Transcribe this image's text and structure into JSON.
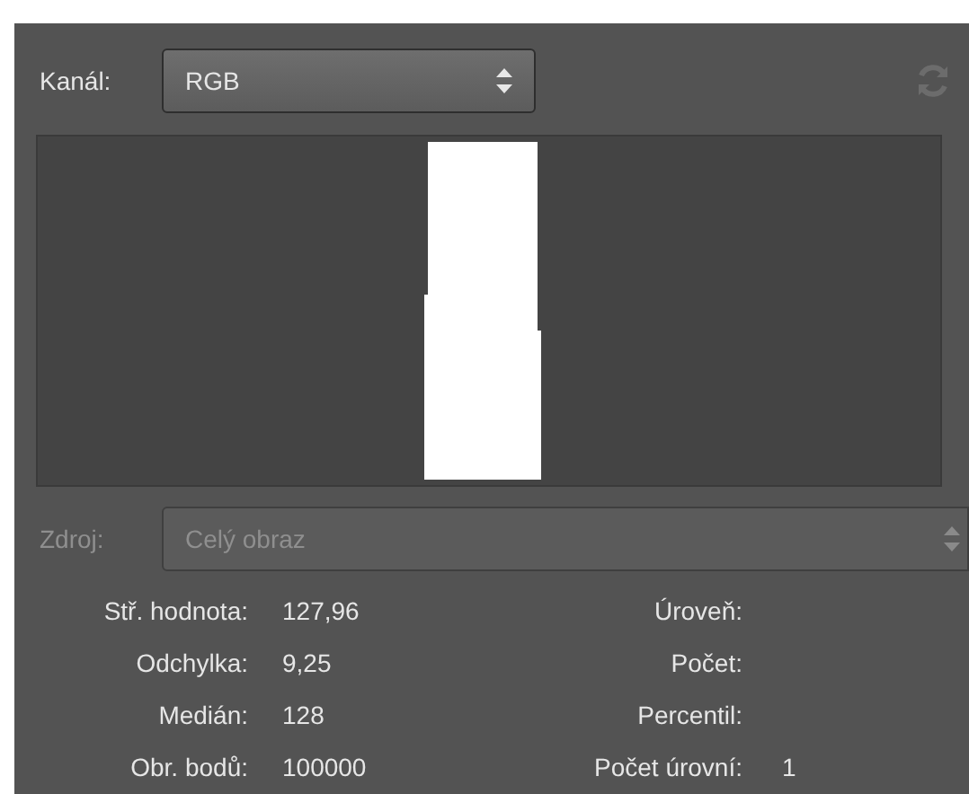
{
  "channel": {
    "label": "Kanál:",
    "value": "RGB"
  },
  "source": {
    "label": "Zdroj:",
    "value": "Celý obraz",
    "disabled": true
  },
  "stats_left": [
    {
      "label": "Stř. hodnota:",
      "value": "127,96"
    },
    {
      "label": "Odchylka:",
      "value": "9,25"
    },
    {
      "label": "Medián:",
      "value": "128"
    },
    {
      "label": "Obr. bodů:",
      "value": "100000"
    }
  ],
  "stats_right": [
    {
      "label": "Úroveň:"
    },
    {
      "label": "Počet:"
    },
    {
      "label": "Percentil:"
    },
    {
      "label": "Počet úrovní:",
      "value": "1"
    }
  ]
}
